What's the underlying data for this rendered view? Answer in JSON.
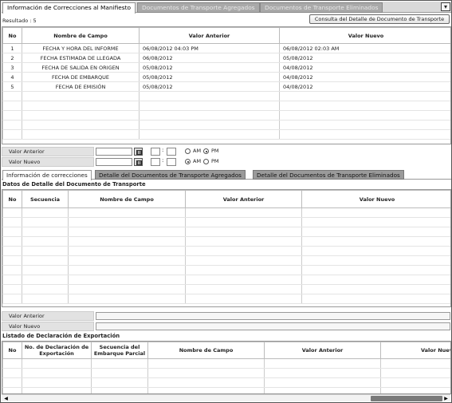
{
  "top_tabs": [
    {
      "label": "Información de Correcciones al Manifiesto"
    },
    {
      "label": "Documentos de Transporte Agregados"
    },
    {
      "label": "Documentos de Transporte Eliminados"
    }
  ],
  "result_label": "Resultado : 5",
  "consulta_button": "Consulta del Detalle de Documento de Transporte",
  "grid1": {
    "headers": [
      "No",
      "Nombre de Campo",
      "Valor Anterior",
      "Valor Nuevo"
    ],
    "rows": [
      [
        "1",
        "FECHA Y HORA DEL INFORME",
        "06/08/2012 04:03 PM",
        "06/08/2012 02:03 AM"
      ],
      [
        "2",
        "FECHA ESTIMADA DE LLEGADA",
        "06/08/2012",
        "05/08/2012"
      ],
      [
        "3",
        "FECHA DE SALIDA EN ORIGEN",
        "05/08/2012",
        "04/08/2012"
      ],
      [
        "4",
        "FECHA DE EMBARQUE",
        "05/08/2012",
        "04/08/2012"
      ],
      [
        "5",
        "FECHA DE EMISIÓN",
        "05/08/2012",
        "04/08/2012"
      ]
    ]
  },
  "form1": {
    "valor_anterior_label": "Valor Anterior",
    "valor_nuevo_label": "Valor Nuevo",
    "colon": ":",
    "am": "AM",
    "pm": "PM"
  },
  "tabs2": [
    {
      "label": "Información de correcciones"
    },
    {
      "label": "Detalle del Documentos de Transporte Agregados"
    },
    {
      "label": "Detalle del Documentos de Transporte Eliminados"
    }
  ],
  "section_detalle": "Datos de Detalle del Documento de Transporte",
  "grid2": {
    "headers": [
      "No",
      "Secuencia",
      "Nombre de Campo",
      "Valor Anterior",
      "Valor Nuevo"
    ]
  },
  "form2": {
    "valor_anterior_label": "Valor Anterior",
    "valor_nuevo_label": "Valor Nuevo"
  },
  "section_listado": "Listado de Declaración de Exportación",
  "grid3": {
    "headers": [
      "No",
      "No. de Declaración de Exportación",
      "Secuencia del Embarque Parcial",
      "Nombre de Campo",
      "Valor Anterior",
      "Valor Nuev"
    ]
  },
  "icons": {
    "dropdown": "chevron-down-icon",
    "calendar": "calendar-icon",
    "scroll_left": "arrow-left-icon",
    "scroll_right": "arrow-right-icon"
  }
}
